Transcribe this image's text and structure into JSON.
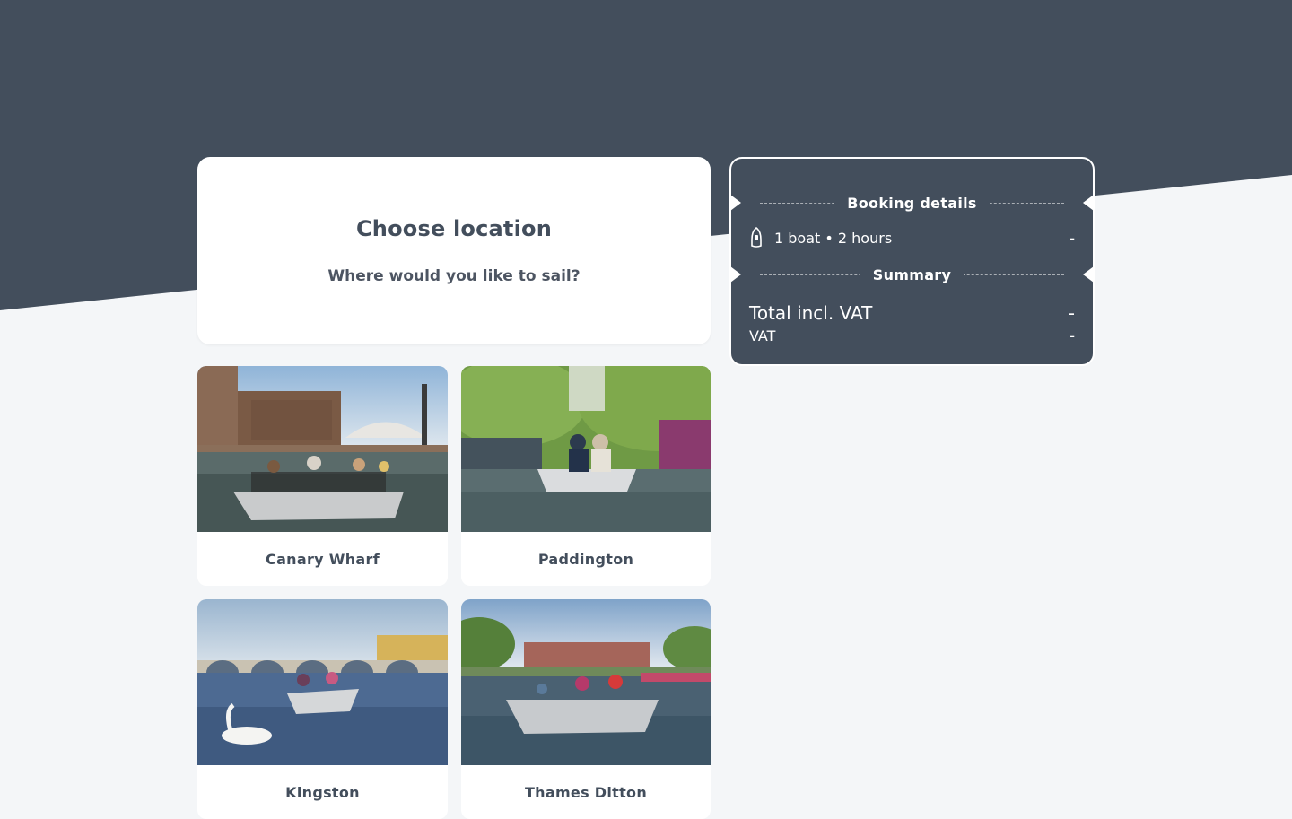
{
  "colors": {
    "header": "#434e5c",
    "page": "#f4f6f8",
    "card": "#ffffff"
  },
  "intro": {
    "title": "Choose location",
    "subtitle": "Where would you like to sail?"
  },
  "locations": [
    {
      "name": "Canary Wharf"
    },
    {
      "name": "Paddington"
    },
    {
      "name": "Kingston"
    },
    {
      "name": "Thames Ditton"
    }
  ],
  "booking": {
    "details_heading": "Booking details",
    "item_icon": "boat-icon",
    "item_text": "1 boat • 2 hours",
    "item_price": "-",
    "summary_heading": "Summary",
    "total_label": "Total incl. VAT",
    "total_value": "-",
    "vat_label": "VAT",
    "vat_value": "-"
  }
}
